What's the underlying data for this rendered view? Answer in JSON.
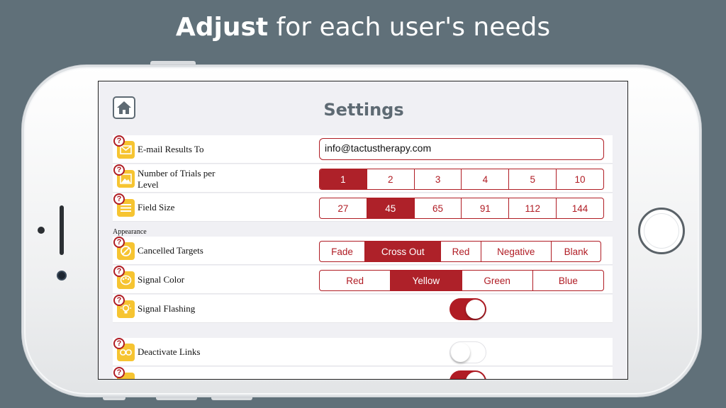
{
  "headline": {
    "bold": "Adjust",
    "rest": " for each user's needs"
  },
  "screen": {
    "title": "Settings",
    "section_appearance": "Appearance",
    "email_label": "E-mail Results To",
    "email_value": "info@tactustherapy.com",
    "trials_label": "Number of Trials per Level",
    "trials_options": [
      "1",
      "2",
      "3",
      "4",
      "5",
      "10"
    ],
    "trials_selected": "1",
    "field_label": "Field Size",
    "field_options": [
      "27",
      "45",
      "65",
      "91",
      "112",
      "144"
    ],
    "field_selected": "45",
    "cancelled_label": "Cancelled Targets",
    "cancelled_options": [
      "Fade",
      "Cross Out",
      "Red",
      "Negative",
      "Blank"
    ],
    "cancelled_selected": "Cross Out",
    "signal_color_label": "Signal Color",
    "signal_color_options": [
      "Red",
      "Yellow",
      "Green",
      "Blue"
    ],
    "signal_color_selected": "Yellow",
    "signal_flashing_label": "Signal Flashing",
    "signal_flashing_on": true,
    "deactivate_links_label": "Deactivate Links",
    "deactivate_links_on": false,
    "help_glyph": "?"
  },
  "colors": {
    "accent": "#b01c24",
    "icon_bg": "#f6c431",
    "background": "#607079"
  }
}
